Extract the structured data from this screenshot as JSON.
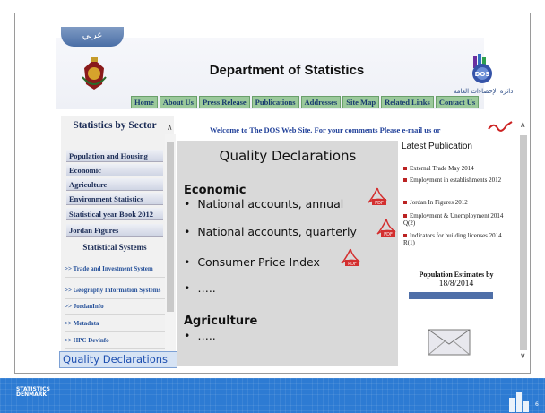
{
  "header": {
    "arabic_tab": "عربي",
    "title": "Department of Statistics",
    "arabic_name": "دائرة الإحصاءات العامة"
  },
  "nav": [
    "Home",
    "About Us",
    "Press Release",
    "Publications",
    "Addresses",
    "Site Map",
    "Related Links",
    "Contact Us"
  ],
  "sidebar": {
    "title": "Statistics by Sector",
    "items": [
      "Population and Housing",
      "Economic",
      "Agriculture",
      "Environment Statistics",
      "Statistical year Book 2012",
      "Jordan Figures"
    ],
    "systems_title": "Statistical Systems",
    "systems": [
      ">> Trade and Investment System",
      ">> Geography Information Systems",
      ">> JordanInfo",
      ">> Metadata",
      ">> HPC Devinfo"
    ]
  },
  "welcome": "Welcome to The DOS Web Site. For your comments Please e-mail us  or",
  "main": {
    "title": "Quality Declarations",
    "sections": [
      {
        "heading": "Economic",
        "bullets": [
          "National accounts, annual",
          "National accounts, quarterly",
          "Consumer Price Index",
          "….."
        ]
      },
      {
        "heading": "Agriculture",
        "bullets": [
          "….."
        ]
      }
    ]
  },
  "latest": {
    "title": "Latest Publication",
    "items": [
      "External Trade May 2014",
      "Employment in establishments 2012",
      "Jordan In Figures 2012",
      "Employment & Unemployment 2014 Q(2)",
      "Indicators for building licenses 2014 R(1)"
    ],
    "population_title": "Population Estimates by",
    "population_date": "18/8/2014"
  },
  "callout": "Quality Declarations",
  "footer": {
    "logo_text": "STATISTICS DENMARK",
    "slide_number": "6"
  },
  "colors": {
    "footer": "#2d7bd3",
    "nav": "#9bc99b",
    "pdf_red": "#d32f2f"
  }
}
